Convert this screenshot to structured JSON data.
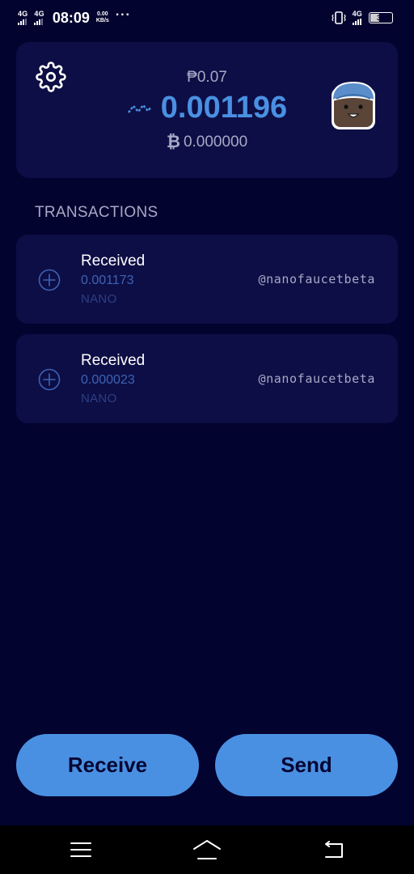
{
  "status_bar": {
    "network_1": "4G",
    "network_2": "4G",
    "time": "08:09",
    "speed_value": "0.00",
    "speed_unit": "KB/s",
    "more": "···",
    "network_right": "4G",
    "battery_level": "39",
    "battery_fraction": 0.39
  },
  "wallet": {
    "local_currency_balance": "₱0.07",
    "nano_balance": "0.001196",
    "btc_symbol": "₿",
    "btc_balance": "0.000000"
  },
  "transactions": {
    "title": "TRANSACTIONS",
    "items": [
      {
        "type": "Received",
        "amount": "0.001173",
        "unit": "NANO",
        "account": "@nanofaucetbeta"
      },
      {
        "type": "Received",
        "amount": "0.000023",
        "unit": "NANO",
        "account": "@nanofaucetbeta"
      }
    ]
  },
  "actions": {
    "receive_label": "Receive",
    "send_label": "Send"
  },
  "colors": {
    "background": "#03032f",
    "card": "#0d0e45",
    "primary": "#4a90e2",
    "text_secondary": "#a7a9c6",
    "tx_amount": "#3c63b5",
    "tx_unit": "#2c3f86"
  },
  "icons": {
    "settings": "gear-icon",
    "nano": "nano-logo-icon",
    "avatar": "monkey-avatar",
    "tx_received": "plus-circle-icon",
    "nav_menu": "menu-icon",
    "nav_home": "home-icon",
    "nav_back": "back-icon"
  }
}
